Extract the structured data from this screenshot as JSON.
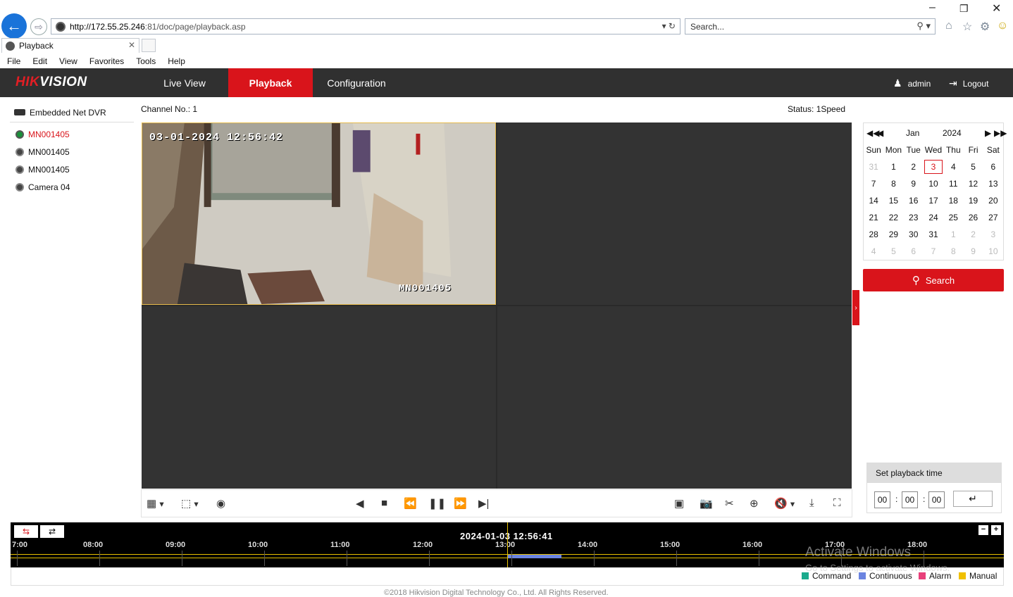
{
  "browser": {
    "url_host": "http://172.55.25.246",
    "url_path": ":81/doc/page/playback.asp",
    "search_placeholder": "Search...",
    "tab_title": "Playback",
    "menu": [
      "File",
      "Edit",
      "View",
      "Favorites",
      "Tools",
      "Help"
    ]
  },
  "header": {
    "logo_a": "HIK",
    "logo_b": "VISION",
    "nav": [
      "Live View",
      "Playback",
      "Configuration"
    ],
    "active_nav": "Playback",
    "user": "admin",
    "logout": "Logout"
  },
  "tree": {
    "device": "Embedded Net DVR",
    "cameras": [
      "MN001405",
      "MN001405",
      "MN001405",
      "Camera 04"
    ],
    "active_index": 0
  },
  "view": {
    "channel_label": "Channel No.: 1",
    "status_label": "Status: 1Speed",
    "osd_time": "03-01-2024 12:56:42",
    "osd_name": "MN001405"
  },
  "calendar": {
    "month": "Jan",
    "year": "2024",
    "weekdays": [
      "Sun",
      "Mon",
      "Tue",
      "Wed",
      "Thu",
      "Fri",
      "Sat"
    ],
    "days": [
      [
        "31",
        "1",
        "2",
        "3",
        "4",
        "5",
        "6"
      ],
      [
        "7",
        "8",
        "9",
        "10",
        "11",
        "12",
        "13"
      ],
      [
        "14",
        "15",
        "16",
        "17",
        "18",
        "19",
        "20"
      ],
      [
        "21",
        "22",
        "23",
        "24",
        "25",
        "26",
        "27"
      ],
      [
        "28",
        "29",
        "30",
        "31",
        "1",
        "2",
        "3"
      ],
      [
        "4",
        "5",
        "6",
        "7",
        "8",
        "9",
        "10"
      ]
    ],
    "selected_day": "3"
  },
  "search_button": "Search",
  "playback_time": {
    "title": "Set playback time",
    "hh": "00",
    "mm": "00",
    "ss": "00"
  },
  "timeline": {
    "current": "2024-01-03 12:56:41",
    "ticks": [
      "7:00",
      "08:00",
      "09:00",
      "10:00",
      "11:00",
      "12:00",
      "13:00",
      "14:00",
      "15:00",
      "16:00",
      "17:00",
      "18:00"
    ],
    "legend": [
      {
        "label": "Command",
        "color": "#1aaa8c"
      },
      {
        "label": "Continuous",
        "color": "#6b84e0"
      },
      {
        "label": "Alarm",
        "color": "#e8407a"
      },
      {
        "label": "Manual",
        "color": "#f0c000"
      }
    ]
  },
  "watermark": {
    "line1": "Activate Windows",
    "line2": "Go to Settings to activate Windows."
  },
  "footer": "©2018 Hikvision Digital Technology Co., Ltd. All Rights Reserved."
}
